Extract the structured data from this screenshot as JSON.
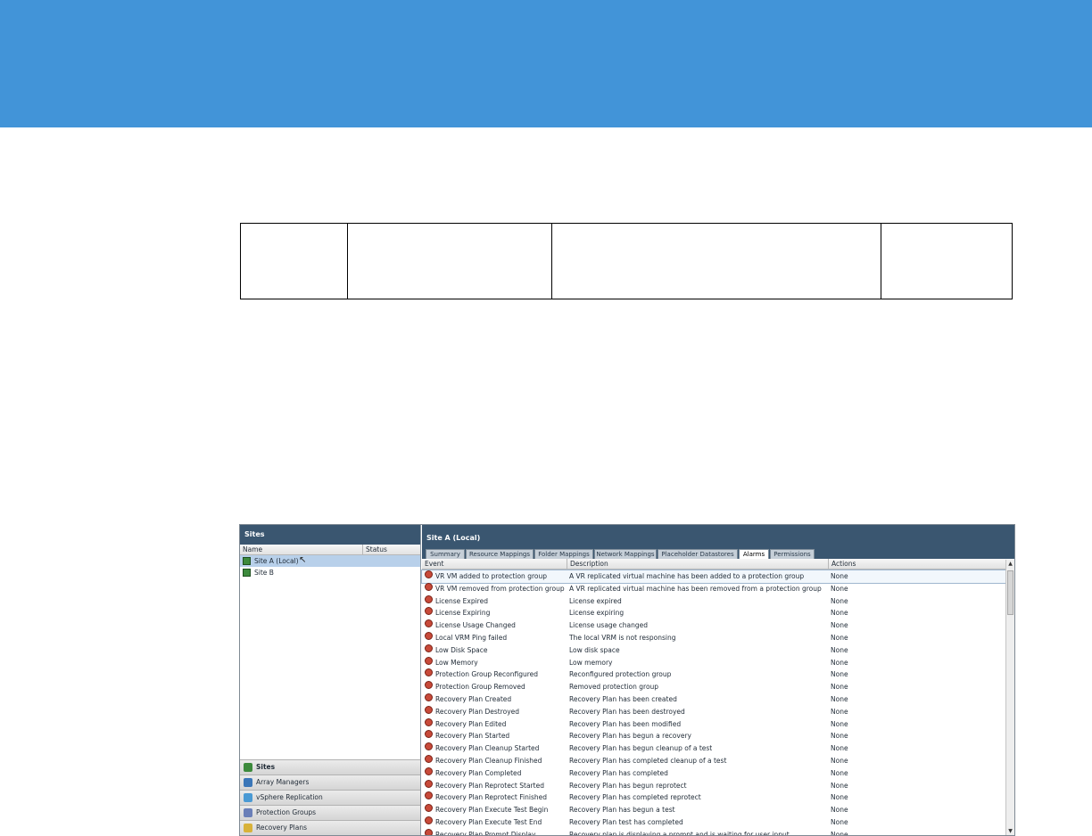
{
  "sites_panel": {
    "title": "Sites",
    "columns": [
      "Name",
      "Status"
    ],
    "sites": [
      {
        "name": "Site A (Local)",
        "selected": true
      },
      {
        "name": "Site B",
        "selected": false
      }
    ],
    "cursor_glyph": "↖"
  },
  "nav": [
    {
      "label": "Sites",
      "icon": "sites-icon",
      "active": true,
      "color": "#3c8a3c"
    },
    {
      "label": "Array Managers",
      "icon": "array-managers-icon",
      "active": false,
      "color": "#3a76b8"
    },
    {
      "label": "vSphere Replication",
      "icon": "vsphere-replication-icon",
      "active": false,
      "color": "#4a9ad4"
    },
    {
      "label": "Protection Groups",
      "icon": "protection-groups-icon",
      "active": false,
      "color": "#6a7fb8"
    },
    {
      "label": "Recovery Plans",
      "icon": "recovery-plans-icon",
      "active": false,
      "color": "#d8b23a"
    }
  ],
  "detail_panel": {
    "title": "Site A (Local)",
    "tabs": [
      "Summary",
      "Resource Mappings",
      "Folder Mappings",
      "Network Mappings",
      "Placeholder Datastores",
      "Alarms",
      "Permissions"
    ],
    "active_tab": "Alarms",
    "columns": [
      "Event",
      "Description",
      "Actions"
    ],
    "alarms": [
      {
        "event": "VR VM added to protection group",
        "description": "A VR replicated virtual machine has been added to a protection group",
        "action": "None"
      },
      {
        "event": "VR VM removed from protection group",
        "description": "A VR replicated virtual machine has been removed from a protection group",
        "action": "None"
      },
      {
        "event": "License Expired",
        "description": "License expired",
        "action": "None"
      },
      {
        "event": "License Expiring",
        "description": "License expiring",
        "action": "None"
      },
      {
        "event": "License Usage Changed",
        "description": "License usage changed",
        "action": "None"
      },
      {
        "event": "Local VRM Ping failed",
        "description": "The local VRM is not responsing",
        "action": "None"
      },
      {
        "event": "Low Disk Space",
        "description": "Low disk space",
        "action": "None"
      },
      {
        "event": "Low Memory",
        "description": "Low memory",
        "action": "None"
      },
      {
        "event": "Protection Group Reconfigured",
        "description": "Reconfigured protection group",
        "action": "None"
      },
      {
        "event": "Protection Group Removed",
        "description": "Removed protection group",
        "action": "None"
      },
      {
        "event": "Recovery Plan Created",
        "description": "Recovery Plan has been created",
        "action": "None"
      },
      {
        "event": "Recovery Plan Destroyed",
        "description": "Recovery Plan has been destroyed",
        "action": "None"
      },
      {
        "event": "Recovery Plan Edited",
        "description": "Recovery Plan has been modified",
        "action": "None"
      },
      {
        "event": "Recovery Plan Started",
        "description": "Recovery Plan has begun a recovery",
        "action": "None"
      },
      {
        "event": "Recovery Plan Cleanup Started",
        "description": "Recovery Plan has begun cleanup of a test",
        "action": "None"
      },
      {
        "event": "Recovery Plan Cleanup Finished",
        "description": "Recovery Plan has completed cleanup of a test",
        "action": "None"
      },
      {
        "event": "Recovery Plan Completed",
        "description": "Recovery Plan has completed",
        "action": "None"
      },
      {
        "event": "Recovery Plan Reprotect Started",
        "description": "Recovery Plan has begun reprotect",
        "action": "None"
      },
      {
        "event": "Recovery Plan Reprotect Finished",
        "description": "Recovery Plan has completed reprotect",
        "action": "None"
      },
      {
        "event": "Recovery Plan Execute Test Begin",
        "description": "Recovery Plan has begun a test",
        "action": "None"
      },
      {
        "event": "Recovery Plan Execute Test End",
        "description": "Recovery Plan test has completed",
        "action": "None"
      },
      {
        "event": "Recovery Plan Prompt Display",
        "description": "Recovery plan is displaying a prompt and is waiting for user input",
        "action": "None"
      }
    ]
  },
  "colors": {
    "banner": "#4294d8",
    "panel_header": "#3a5670",
    "alarm_icon": "#c84a3a"
  }
}
